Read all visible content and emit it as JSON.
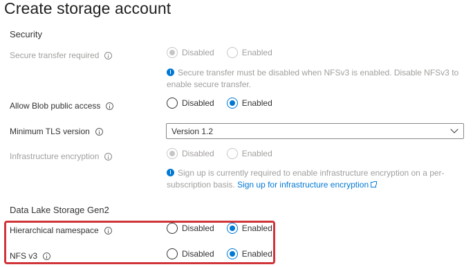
{
  "page": {
    "title": "Create storage account"
  },
  "sections": {
    "security": "Security",
    "data_lake": "Data Lake Storage Gen2"
  },
  "fields": {
    "secure_transfer": {
      "label": "Secure transfer required",
      "options": [
        "Disabled",
        "Enabled"
      ],
      "selected": "Disabled",
      "disabled": true,
      "info": "Secure transfer must be disabled when NFSv3 is enabled. Disable NFSv3 to enable secure transfer."
    },
    "blob_public_access": {
      "label": "Allow Blob public access",
      "options": [
        "Disabled",
        "Enabled"
      ],
      "selected": "Enabled"
    },
    "min_tls": {
      "label": "Minimum TLS version",
      "value": "Version 1.2"
    },
    "infra_encryption": {
      "label": "Infrastructure encryption",
      "options": [
        "Disabled",
        "Enabled"
      ],
      "selected": "Disabled",
      "disabled": true,
      "info": "Sign up is currently required to enable infrastructure encryption on a per-subscription basis.",
      "link": "Sign up for infrastructure encryption"
    },
    "hierarchical_namespace": {
      "label": "Hierarchical namespace",
      "options": [
        "Disabled",
        "Enabled"
      ],
      "selected": "Enabled"
    },
    "nfs_v3": {
      "label": "NFS v3",
      "options": [
        "Disabled",
        "Enabled"
      ],
      "selected": "Enabled"
    }
  },
  "colors": {
    "accent": "#0078d4",
    "highlight": "#d13438"
  }
}
